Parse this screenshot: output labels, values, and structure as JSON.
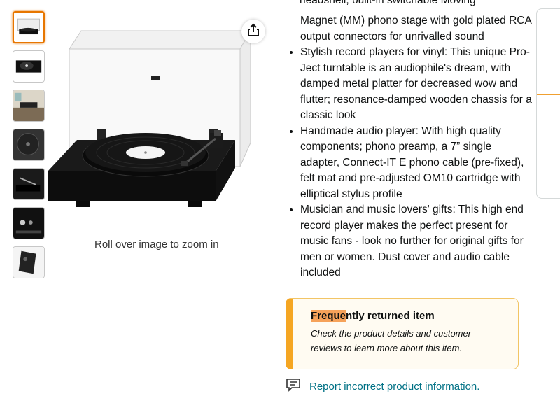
{
  "share": {
    "icon": "share-icon"
  },
  "thumbnails": [
    {
      "alt": "turntable-with-cover",
      "selected": true
    },
    {
      "alt": "turntable-top"
    },
    {
      "alt": "turntable-room"
    },
    {
      "alt": "platter-closeup"
    },
    {
      "alt": "tonearm-detail"
    },
    {
      "alt": "back-panel"
    },
    {
      "alt": "turntable-angle"
    }
  ],
  "main_image": {
    "hint": "Roll over image to zoom in"
  },
  "features": {
    "top_fragment": "headshell, built-in switchable Moving",
    "intro": "Magnet (MM) phono stage with gold plated RCA output connectors for unrivalled sound",
    "bullets": [
      "Stylish record players for vinyl: This unique Pro-Ject turntable is an audiophile's dream, with damped metal platter for decreased wow and flutter; resonance-damped wooden chassis for a classic look",
      "Handmade audio player: With high quality components; phono preamp, a 7” single adapter, Connect-IT E phono cable (pre-fixed), felt mat and pre-adjusted OM10 cartridge with elliptical stylus profile",
      "Musician and music lovers' gifts: This high end record player makes the perfect present for music fans - look no further for original gifts for men or women. Dust cover and audio cable included"
    ]
  },
  "frequently_returned": {
    "title_highlight": "Freque",
    "title_rest": "ntly returned item",
    "line1": "Check the product details and customer",
    "line2": "reviews to learn more about this item."
  },
  "report": {
    "label": "Report incorrect product information."
  },
  "colors": {
    "accent": "#f5a623",
    "link": "#007185",
    "selected_thumb": "#e77600"
  }
}
